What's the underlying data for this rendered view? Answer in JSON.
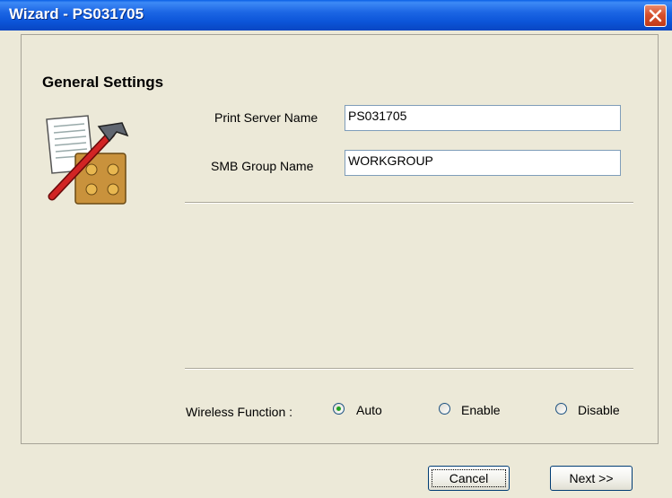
{
  "window": {
    "title": "Wizard - PS031705"
  },
  "group": {
    "title": "General Settings"
  },
  "fields": {
    "print_server_label": "Print Server Name",
    "print_server_value": "PS031705",
    "smb_group_label": "SMB Group Name",
    "smb_group_value": "WORKGROUP"
  },
  "wireless": {
    "label": "Wireless Function :",
    "options": [
      "Auto",
      "Enable",
      "Disable"
    ],
    "selected": "Auto"
  },
  "buttons": {
    "cancel": "Cancel",
    "next": "Next >>"
  },
  "icons": {
    "settings": "tools-document-icon",
    "close": "close-icon"
  }
}
